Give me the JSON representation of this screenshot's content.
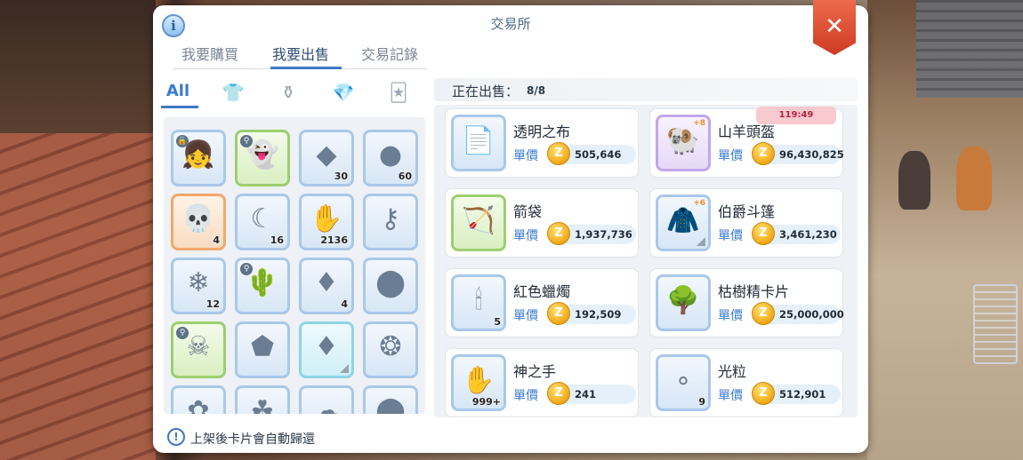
{
  "window": {
    "title": "交易所",
    "info_icon": "info-icon",
    "close_icon": "close-icon",
    "close_glyph": "✕",
    "info_glyph": "i"
  },
  "tabs": [
    {
      "label": "我要購買",
      "active": false
    },
    {
      "label": "我要出售",
      "active": true
    },
    {
      "label": "交易記錄",
      "active": false
    }
  ],
  "filters": [
    {
      "label": "All",
      "icon": "all",
      "active": true
    },
    {
      "label": "",
      "icon": "armor-icon",
      "glyph": "👕",
      "active": false
    },
    {
      "label": "",
      "icon": "potion-icon",
      "glyph": "⚱",
      "active": false
    },
    {
      "label": "",
      "icon": "gem-icon",
      "glyph": "💎",
      "active": false
    },
    {
      "label": "",
      "icon": "card-icon",
      "glyph": "🃏",
      "active": false
    }
  ],
  "inventory": [
    {
      "icon": "girl-headgear-icon",
      "glyph": "👧",
      "count": "",
      "style": "",
      "badge": "🔒"
    },
    {
      "icon": "dark-pet-icon",
      "glyph": "👻",
      "count": "",
      "style": "green",
      "badge": "⚲"
    },
    {
      "icon": "crystal-shard-icon",
      "glyph": "◆",
      "count": "30",
      "style": ""
    },
    {
      "icon": "coal-icon",
      "glyph": "●",
      "count": "60",
      "style": ""
    },
    {
      "icon": "skull-mask-icon",
      "glyph": "💀",
      "count": "4",
      "style": "orange"
    },
    {
      "icon": "ghost-icon",
      "glyph": "☾",
      "count": "16",
      "style": ""
    },
    {
      "icon": "hand-icon",
      "glyph": "✋",
      "count": "2136",
      "style": ""
    },
    {
      "icon": "key-icon",
      "glyph": "⚷",
      "count": "",
      "style": ""
    },
    {
      "icon": "ice-crystal-icon",
      "glyph": "❄",
      "count": "12",
      "style": ""
    },
    {
      "icon": "cactus-icon",
      "glyph": "🌵",
      "count": "",
      "style": "",
      "badge": "⚲"
    },
    {
      "icon": "blue-gem-icon",
      "glyph": "♦",
      "count": "4",
      "style": ""
    },
    {
      "icon": "red-orb-icon",
      "glyph": "⬤",
      "count": "",
      "style": ""
    },
    {
      "icon": "skeleton-icon",
      "glyph": "☠",
      "count": "",
      "style": "green",
      "badge": "⚲"
    },
    {
      "icon": "shield-scale-icon",
      "glyph": "⬟",
      "count": "",
      "style": ""
    },
    {
      "icon": "dark-crystal-icon",
      "glyph": "♦",
      "count": "",
      "style": "cyan",
      "corner": true
    },
    {
      "icon": "thorn-ring-icon",
      "glyph": "❂",
      "count": "",
      "style": ""
    },
    {
      "icon": "item-icon",
      "glyph": "✿",
      "count": "",
      "style": ""
    },
    {
      "icon": "item-icon",
      "glyph": "☘",
      "count": "",
      "style": ""
    },
    {
      "icon": "item-icon",
      "glyph": "☁",
      "count": "",
      "style": ""
    },
    {
      "icon": "item-icon",
      "glyph": "⬤",
      "count": "",
      "style": ""
    }
  ],
  "selling": {
    "label": "正在出售：",
    "count": "8/8",
    "unit_label": "單價",
    "coin_glyph": "Z",
    "listings": [
      {
        "name": "透明之布",
        "price": "505,646",
        "icon": "transparent-cloth-icon",
        "glyph": "📄",
        "count": "",
        "style": ""
      },
      {
        "name": "山羊頭盔",
        "price": "96,430,825",
        "icon": "goat-helm-icon",
        "glyph": "🐏",
        "count": "",
        "style": "purple",
        "refine": "+8",
        "timer": "119:49"
      },
      {
        "name": "箭袋",
        "price": "1,937,736",
        "icon": "quiver-icon",
        "glyph": "🏹",
        "count": "",
        "style": "green"
      },
      {
        "name": "伯爵斗篷",
        "price": "3,461,230",
        "icon": "cloak-icon",
        "glyph": "🧥",
        "count": "",
        "style": "",
        "refine": "+6",
        "corner": true
      },
      {
        "name": "紅色蠟燭",
        "price": "192,509",
        "icon": "red-candle-icon",
        "glyph": "🕯",
        "count": "5",
        "style": ""
      },
      {
        "name": "枯樹精卡片",
        "price": "25,000,000",
        "icon": "card-icon",
        "glyph": "🌳",
        "count": "",
        "style": ""
      },
      {
        "name": "神之手",
        "price": "241",
        "icon": "gods-hand-icon",
        "glyph": "✋",
        "count": "999+",
        "style": ""
      },
      {
        "name": "光粒",
        "price": "512,901",
        "icon": "light-particle-icon",
        "glyph": "∘",
        "count": "9",
        "style": ""
      }
    ]
  },
  "footer": {
    "note": "上架後卡片會自動歸還",
    "icon": "alert-icon",
    "glyph": "!"
  }
}
